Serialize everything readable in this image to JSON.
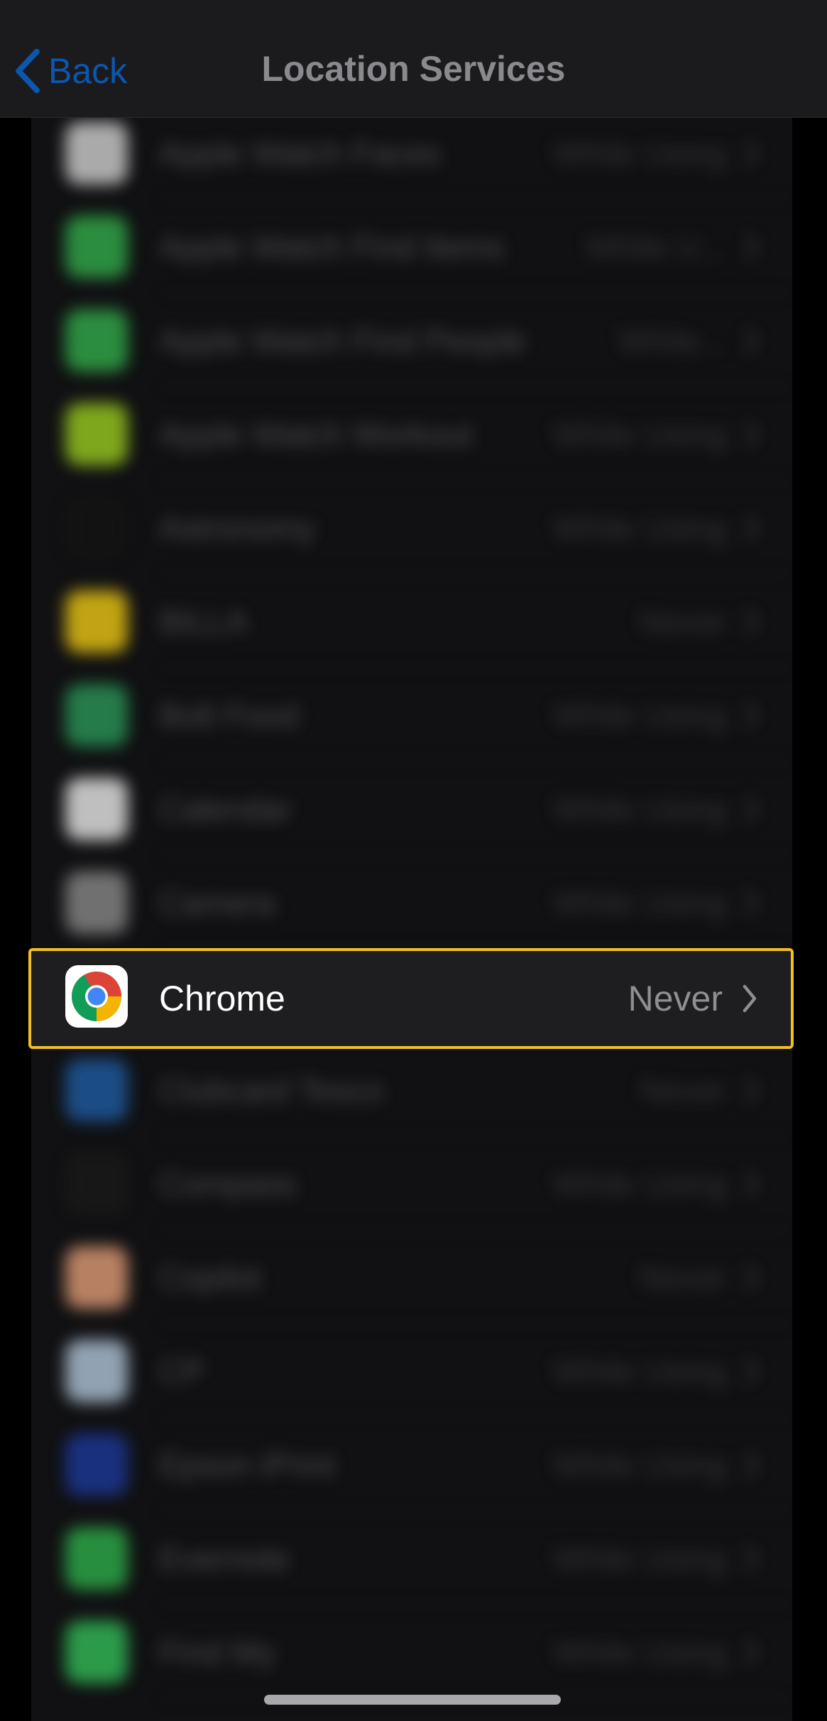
{
  "nav": {
    "back_label": "Back",
    "title": "Location Services",
    "accent_color": "#0a84ff"
  },
  "apps": [
    {
      "name": "Apple Watch Faces",
      "value": "While Using",
      "icon_color": "#d8d8d8"
    },
    {
      "name": "Apple Watch Find Items",
      "value": "While U...",
      "icon_color": "#34b24c"
    },
    {
      "name": "Apple Watch Find People",
      "value": "While...",
      "icon_color": "#34b24c"
    },
    {
      "name": "Apple Watch Workout",
      "value": "While Using",
      "icon_color": "#9fd321"
    },
    {
      "name": "Astronomy",
      "value": "While Using",
      "icon_color": "#141414"
    },
    {
      "name": "BILLA",
      "value": "Never",
      "icon_color": "#f5cf14"
    },
    {
      "name": "Bolt Food",
      "value": "While Using",
      "icon_color": "#2c9b5a"
    },
    {
      "name": "Calendar",
      "value": "While Using",
      "icon_color": "#f2f2f2"
    },
    {
      "name": "Camera",
      "value": "While Using",
      "icon_color": "#8d8d8d"
    },
    {
      "name": "Chrome",
      "value": "Never",
      "icon_color": "#ffffff"
    },
    {
      "name": "Clubcard Tesco",
      "value": "Never",
      "icon_color": "#1f5fa8"
    },
    {
      "name": "Compass",
      "value": "While Using",
      "icon_color": "#1a1a1a"
    },
    {
      "name": "Copilot",
      "value": "Never",
      "icon_color": "#e9a27a"
    },
    {
      "name": "CP",
      "value": "While Using",
      "icon_color": "#b7cde0"
    },
    {
      "name": "Epson iPrint",
      "value": "While Using",
      "icon_color": "#1c3a9e"
    },
    {
      "name": "Evernote",
      "value": "While Using",
      "icon_color": "#2fb44c"
    },
    {
      "name": "Find My",
      "value": "While Using",
      "icon_color": "#34c35a"
    }
  ],
  "highlight": {
    "name": "Chrome",
    "value": "Never",
    "border_color": "#f2bf21",
    "icon": "chrome-icon"
  }
}
